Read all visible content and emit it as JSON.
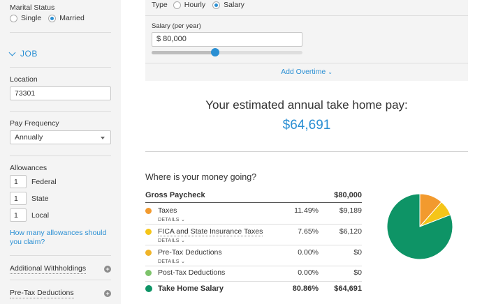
{
  "sidebar": {
    "marital_status_label": "Marital Status",
    "marital_options": [
      {
        "label": "Single",
        "selected": false
      },
      {
        "label": "Married",
        "selected": true
      }
    ],
    "job_section": "JOB",
    "location_label": "Location",
    "location_value": "73301",
    "pay_frequency_label": "Pay Frequency",
    "pay_frequency_value": "Annually",
    "allowances_label": "Allowances",
    "allowances": [
      {
        "value": "1",
        "label": "Federal"
      },
      {
        "value": "1",
        "label": "State"
      },
      {
        "value": "1",
        "label": "Local"
      }
    ],
    "allowances_help_link": "How many allowances should you claim?",
    "additional_withholdings": "Additional Withholdings",
    "pretax_deductions": "Pre-Tax Deductions"
  },
  "form": {
    "type_label": "Type",
    "type_options": [
      {
        "label": "Hourly",
        "selected": false
      },
      {
        "label": "Salary",
        "selected": true
      }
    ],
    "salary_label": "Salary (per year)",
    "salary_value": "$ 80,000",
    "salary_slider_fraction": 0.42,
    "add_overtime": "Add Overtime"
  },
  "results": {
    "headline": "Your estimated annual take home pay:",
    "take_home": "$64,691",
    "where_heading": "Where is your money going?",
    "gross_label": "Gross Paycheck",
    "gross_amount": "$80,000",
    "details_label": "DETAILS",
    "rows": [
      {
        "name": "Taxes",
        "pct": "11.49%",
        "amount": "$9,189",
        "color": "#f29a2e",
        "details": true
      },
      {
        "name": "FICA and State Insurance Taxes",
        "pct": "7.65%",
        "amount": "$6,120",
        "color": "#f5c518",
        "details": true
      },
      {
        "name": "Pre-Tax Deductions",
        "pct": "0.00%",
        "amount": "$0",
        "color": "#f0b429",
        "details": true
      },
      {
        "name": "Post-Tax Deductions",
        "pct": "0.00%",
        "amount": "$0",
        "color": "#7dc36b",
        "details": false
      },
      {
        "name": "Take Home Salary",
        "pct": "80.86%",
        "amount": "$64,691",
        "color": "#0e9466",
        "details": false
      }
    ]
  },
  "colors": {
    "accent": "#2a8fd3",
    "taxes": "#f29a2e",
    "fica": "#f5c518",
    "take_home": "#0e9466"
  }
}
